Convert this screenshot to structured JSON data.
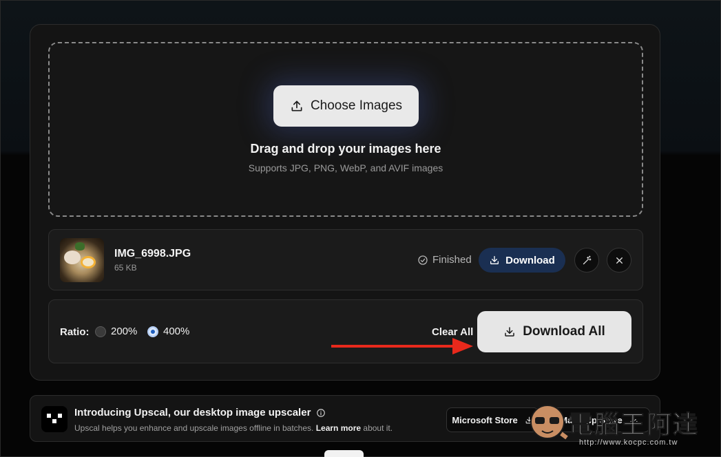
{
  "upload": {
    "choose_label": "Choose Images",
    "drop_title": "Drag and drop your images here",
    "drop_subtitle": "Supports JPG, PNG, WebP, and AVIF images"
  },
  "file": {
    "name": "IMG_6998.JPG",
    "size": "65 KB",
    "status": "Finished",
    "download_label": "Download"
  },
  "bulk": {
    "ratio_label": "Ratio:",
    "options": [
      "200%",
      "400%"
    ],
    "selected": "400%",
    "clear_label": "Clear All",
    "download_all_label": "Download All"
  },
  "promo": {
    "title": "Introducing Upscal, our desktop image upscaler",
    "subtitle_pre": "Upscal helps you enhance and upscale images offline in batches.",
    "subtitle_link": "Learn more",
    "subtitle_post": "about it.",
    "store_microsoft": "Microsoft Store",
    "store_mac": "Mac App Store"
  },
  "watermark": {
    "brand": "電腦王阿達",
    "url": "http://www.kocpc.com.tw"
  },
  "colors": {
    "accent_download": "#1a2f52",
    "annotation_arrow": "#e8291c",
    "radio_selected": "#1f5fbf"
  }
}
